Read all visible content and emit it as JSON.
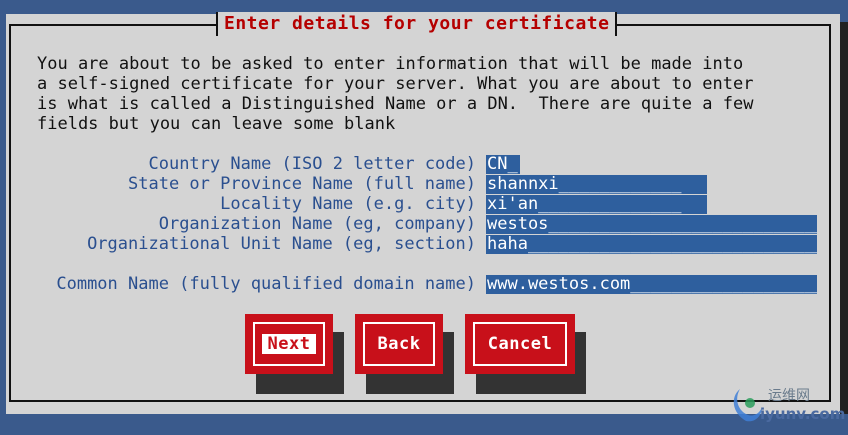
{
  "dialog": {
    "title": "Enter details for your certificate",
    "intro": "You are about to be asked to enter information that will be made into\na self-signed certificate for your server. What you are about to enter\nis what is called a Distinguished Name or a DN.  There are quite a few\nfields but you can leave some blank"
  },
  "fields": [
    {
      "label": "Country Name (ISO 2 letter code)",
      "value": "CN_"
    },
    {
      "label": "State or Province Name (full name)",
      "value": "shannxi____________"
    },
    {
      "label": "Locality Name (e.g. city)",
      "value": "xi'an______________"
    },
    {
      "label": "Organization Name (eg, company)",
      "value": "westos___________________________"
    },
    {
      "label": "Organizational Unit Name (eg, section)",
      "value": "haha_____________________________"
    },
    {
      "label": "Common Name (fully qualified domain name)",
      "value": "www.westos.com___________________"
    }
  ],
  "buttons": {
    "next": "Next",
    "back": "Back",
    "cancel": "Cancel"
  },
  "watermark": {
    "line1": "运维网",
    "line2": "iyunv.com"
  }
}
